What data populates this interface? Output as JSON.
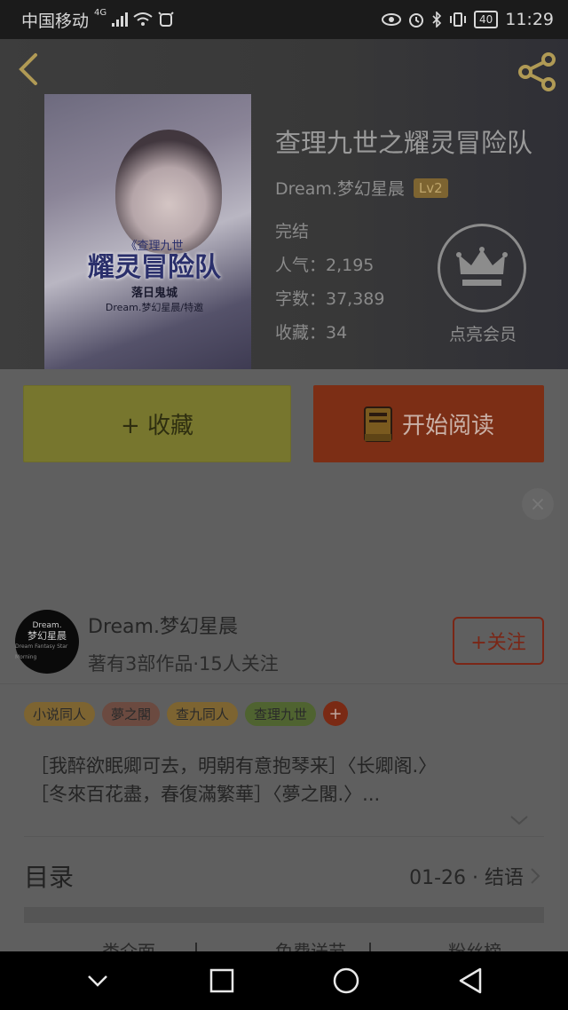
{
  "status_bar": {
    "carrier": "中国移动",
    "network": "4G",
    "battery": "40",
    "time": "11:29"
  },
  "book": {
    "title": "查理九世之耀灵冒险队",
    "author": "Dream.梦幻星晨",
    "level": "Lv2",
    "status": "完结",
    "popularity": "人气：2,195",
    "word_count": "字数：37,389",
    "favorites": "收藏：34",
    "cover": {
      "series": "《查理九世",
      "title": "耀灵冒险队",
      "volume": "落日鬼城",
      "author": "Dream.梦幻星晨/特邀"
    }
  },
  "vip": {
    "label": "点亮会员"
  },
  "actions": {
    "collect_label": "+ 收藏",
    "read_label": "开始阅读"
  },
  "author_card": {
    "avatar": {
      "line1": "Dream.",
      "line2": "梦幻星晨",
      "line3": "Dream Fantasy Star Morning"
    },
    "name": "Dream.梦幻星晨",
    "desc": "著有3部作品·15人关注",
    "follow_label": "+关注"
  },
  "tags": [
    {
      "label": "小说同人",
      "color": "#7d6431"
    },
    {
      "label": "夢之閣",
      "color": "#6b4a40"
    },
    {
      "label": "查九同人",
      "color": "#7d6431"
    },
    {
      "label": "查理九世",
      "color": "#4f6330"
    }
  ],
  "tag_more": "+",
  "intro": {
    "line1": "［我醉欲眠卿可去，明朝有意抱琴来］〈长卿阁.〉",
    "line2": "［冬來百花盡，春復滿繁華］〈夢之閣.〉..."
  },
  "toc": {
    "label": "目录",
    "latest": "01-26 · 结语"
  },
  "bottom_tabs": [
    "类介面",
    "免费送节",
    "粉丝榜"
  ]
}
